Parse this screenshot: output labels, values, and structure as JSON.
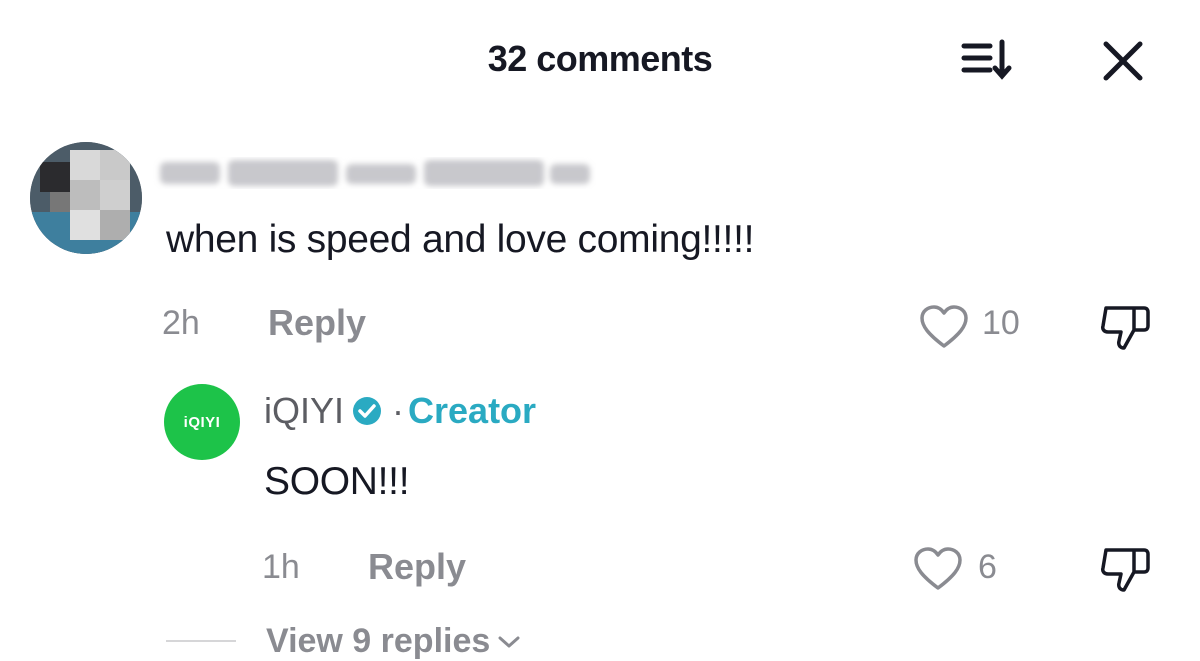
{
  "header": {
    "title": "32 comments"
  },
  "comment1": {
    "text": "when is speed and love coming!!!!!",
    "time": "2h",
    "reply_label": "Reply",
    "like_count": "10"
  },
  "reply1": {
    "avatar_text": "iQIYI",
    "author": "iQIYI",
    "separator": "·",
    "badge": "Creator",
    "text": "SOON!!!",
    "time": "1h",
    "reply_label": "Reply",
    "like_count": "6"
  },
  "view_replies": {
    "label": "View 9 replies"
  },
  "colors": {
    "creator": "#2aaac2",
    "verified": "#2aaac2",
    "iqiyi_green": "#1dc349"
  },
  "icons": [
    "sort-icon",
    "close-icon",
    "heart-icon",
    "dislike-icon",
    "verified-icon",
    "chevron-down-icon"
  ]
}
